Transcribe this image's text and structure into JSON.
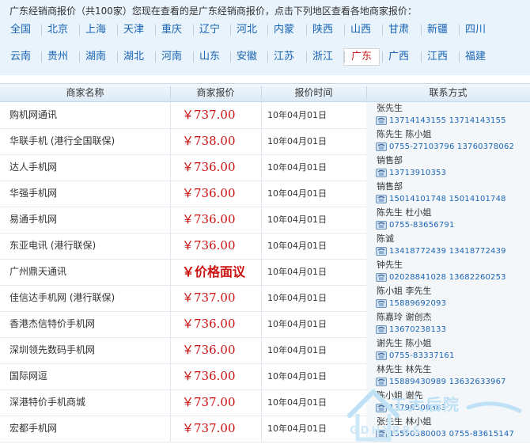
{
  "header": {
    "title": "广东经销商报价（共100家）您现在查看的是广东经销商报价，点击下列地区查看各地商家报价："
  },
  "regions": [
    [
      "全国",
      "北京",
      "上海",
      "天津",
      "重庆",
      "辽宁",
      "河北",
      "内蒙",
      "陕西",
      "山西",
      "甘肃",
      "新疆",
      "四川"
    ],
    [
      "云南",
      "贵州",
      "湖南",
      "湖北",
      "河南",
      "山东",
      "安徽",
      "江苏",
      "浙江",
      "广东",
      "广西",
      "江西",
      "福建"
    ]
  ],
  "selected_region": "广东",
  "table": {
    "headers": [
      "商家名称",
      "商家报价",
      "报价时间",
      "联系方式"
    ],
    "rows": [
      {
        "name": "购机网通讯",
        "price": "￥737.00",
        "date": "10年04月01日",
        "contact": "张先生",
        "phones": "13714143155 13714143155"
      },
      {
        "name": "华联手机 (港行全国联保)",
        "price": "￥738.00",
        "date": "10年04月01日",
        "contact": "陈先生 陈小姐",
        "phones": "0755-27103796 13760378062"
      },
      {
        "name": "达人手机网",
        "price": "￥736.00",
        "date": "10年04月01日",
        "contact": "销售部",
        "phones": "13713910353"
      },
      {
        "name": "华强手机网",
        "price": "￥736.00",
        "date": "10年04月01日",
        "contact": "销售部",
        "phones": "15014101748 15014101748"
      },
      {
        "name": "易通手机网",
        "price": "￥736.00",
        "date": "10年04月01日",
        "contact": "陈先生 杜小姐",
        "phones": "0755-83656791"
      },
      {
        "name": "东亚电讯 (港行联保)",
        "price": "￥736.00",
        "date": "10年04月01日",
        "contact": "陈诚",
        "phones": "13418772439 13418772439"
      },
      {
        "name": "广州鼎天通讯",
        "price": "￥价格面议",
        "date": "10年04月01日",
        "contact": "钟先生",
        "phones": "02028841028 13682260253"
      },
      {
        "name": "佳信达手机网 (港行联保)",
        "price": "￥737.00",
        "date": "10年04月01日",
        "contact": "陈小姐 李先生",
        "phones": "15889692093"
      },
      {
        "name": "香港杰信特价手机网",
        "price": "￥736.00",
        "date": "10年04月01日",
        "contact": "陈嘉玲 谢创杰",
        "phones": "13670238133"
      },
      {
        "name": "深圳领先数码手机网",
        "price": "￥736.00",
        "date": "10年04月01日",
        "contact": "谢先生 陈小姐",
        "phones": "0755-83337161"
      },
      {
        "name": "国际网逗",
        "price": "￥736.00",
        "date": "10年04月01日",
        "contact": "林先生 林先生",
        "phones": "15889430989 13632633967"
      },
      {
        "name": "深港特价手机商城",
        "price": "￥737.00",
        "date": "10年04月01日",
        "contact": "陈小姐 谢先",
        "phones": "13798508383"
      },
      {
        "name": "宏都手机网",
        "price": "￥737.00",
        "date": "10年04月01日",
        "contact": "张先生 林小姐",
        "phones": "13590380003 0755-83615147"
      }
    ]
  },
  "watermark": {
    "text": "工大后院",
    "sub": "GDHYBBS"
  },
  "colors": {
    "link": "#1a64b4",
    "price": "#cc1111",
    "header_bg": "#e9f3fb"
  }
}
